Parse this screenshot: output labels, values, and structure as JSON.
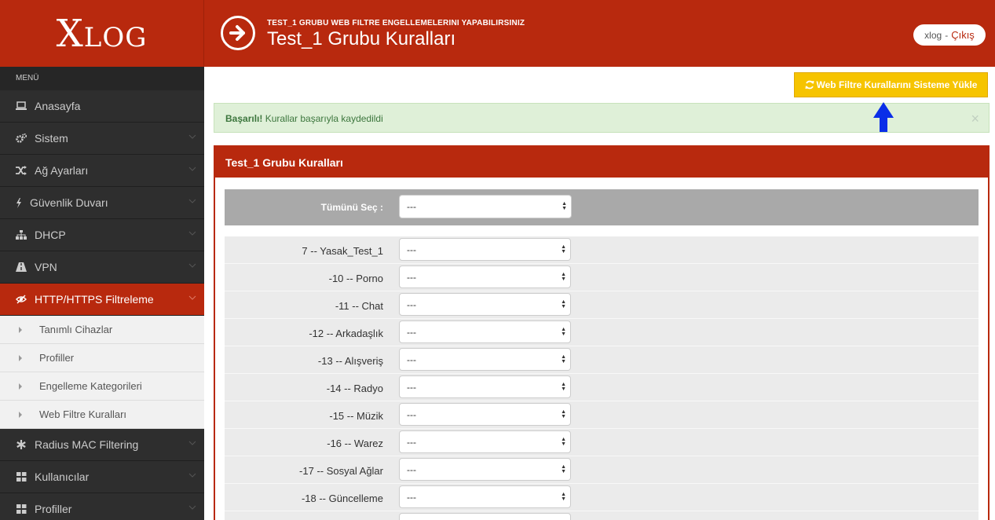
{
  "header": {
    "logo": "XLOG",
    "subtitle": "TEST_1 GRUBU WEB FILTRE ENGELLEMELERINI YAPABILIRSINIZ",
    "title": "Test_1 Grubu Kuralları",
    "user": "xlog",
    "separator": "-",
    "logout": "Çıkış"
  },
  "sidebar": {
    "menu_label": "MENÜ",
    "items": [
      {
        "label": "Anasayfa",
        "icon": "laptop-icon"
      },
      {
        "label": "Sistem",
        "icon": "cogs-icon"
      },
      {
        "label": "Ağ Ayarları",
        "icon": "random-icon"
      },
      {
        "label": "Güvenlik Duvarı",
        "icon": "bolt-icon"
      },
      {
        "label": "DHCP",
        "icon": "sitemap-icon"
      },
      {
        "label": "VPN",
        "icon": "road-icon"
      },
      {
        "label": "HTTP/HTTPS Filtreleme",
        "icon": "eye-slash-icon"
      }
    ],
    "sub_items": [
      {
        "label": "Tanımlı Cihazlar"
      },
      {
        "label": "Profiller"
      },
      {
        "label": "Engelleme Kategorileri"
      },
      {
        "label": "Web Filtre Kuralları"
      }
    ],
    "items_after": [
      {
        "label": "Radius MAC Filtering",
        "icon": "asterisk-icon"
      },
      {
        "label": "Kullanıcılar",
        "icon": "th-large-icon"
      },
      {
        "label": "Profiller",
        "icon": "th-large-icon"
      }
    ]
  },
  "toolbar": {
    "load_button": "Web Filtre Kurallarını Sisteme Yükle"
  },
  "alert": {
    "strong": "Başarılı!",
    "message": " Kurallar başarıyla kaydedildi",
    "close": "×"
  },
  "panel": {
    "title": "Test_1 Grubu Kuralları",
    "select_all_label": "Tümünü Seç :",
    "select_all_value": "---",
    "rules": [
      {
        "id": "7",
        "sep": " -- ",
        "name": "Yasak_Test_1",
        "value": "---"
      },
      {
        "id": "-10",
        "sep": " -- ",
        "name": "Porno",
        "value": "---"
      },
      {
        "id": "-11",
        "sep": " -- ",
        "name": "Chat",
        "value": "---"
      },
      {
        "id": "-12",
        "sep": " -- ",
        "name": "Arkadaşlık",
        "value": "---"
      },
      {
        "id": "-13",
        "sep": " -- ",
        "name": "Alışveriş",
        "value": "---"
      },
      {
        "id": "-14",
        "sep": " -- ",
        "name": "Radyo",
        "value": "---"
      },
      {
        "id": "-15",
        "sep": " -- ",
        "name": "Müzik",
        "value": "---"
      },
      {
        "id": "-16",
        "sep": " -- ",
        "name": "Warez",
        "value": "---"
      },
      {
        "id": "-17",
        "sep": " -- ",
        "name": "Sosyal Ağlar",
        "value": "---"
      },
      {
        "id": "-18",
        "sep": " -- ",
        "name": "Güncelleme",
        "value": "---"
      },
      {
        "id": "",
        "sep": "",
        "name": "",
        "value": ""
      }
    ]
  },
  "colors": {
    "brand": "#b8290e",
    "sidebar": "#2e2e2e",
    "button": "#f6c400",
    "alert_bg": "#dff0d8",
    "arrow": "#0a2ee8"
  }
}
